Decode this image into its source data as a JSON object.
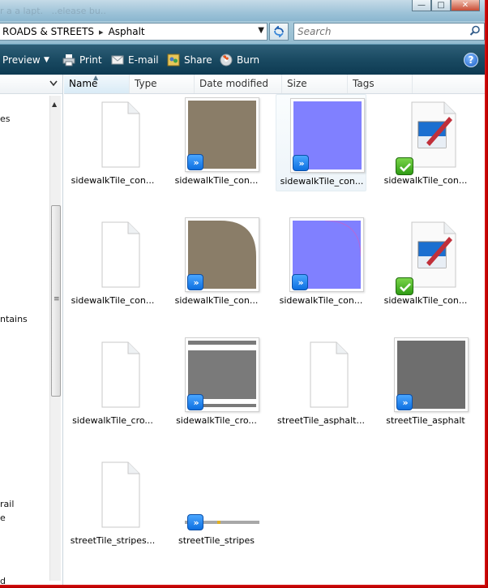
{
  "titlebar": {
    "ghost_text": "r a a lapt.   ..elease bu.."
  },
  "address": {
    "crumbs": [
      "ROADS & STREETS",
      "Asphalt"
    ]
  },
  "search": {
    "placeholder": "Search"
  },
  "toolbar": {
    "preview": "Preview",
    "print": "Print",
    "email": "E-mail",
    "share": "Share",
    "burn": "Burn"
  },
  "nav": {
    "fragments": [
      "es",
      "ntains",
      "rail",
      "e",
      "d"
    ]
  },
  "columns": [
    "Name",
    "Type",
    "Date modified",
    "Size",
    "Tags"
  ],
  "files": [
    {
      "name": "sidewalkTile_con...",
      "kind": "blank"
    },
    {
      "name": "sidewalkTile_con...",
      "kind": "brown",
      "badge": "shortcut"
    },
    {
      "name": "sidewalkTile_con...",
      "kind": "blue",
      "badge": "shortcut",
      "selected": true
    },
    {
      "name": "sidewalkTile_con...",
      "kind": "paint",
      "badge": "check"
    },
    {
      "name": "sidewalkTile_con...",
      "kind": "blank"
    },
    {
      "name": "sidewalkTile_con...",
      "kind": "brown-curve",
      "badge": "shortcut"
    },
    {
      "name": "sidewalkTile_con...",
      "kind": "blue-curve",
      "badge": "shortcut"
    },
    {
      "name": "sidewalkTile_con...",
      "kind": "paint",
      "badge": "check"
    },
    {
      "name": "sidewalkTile_cro...",
      "kind": "blank"
    },
    {
      "name": "sidewalkTile_cro...",
      "kind": "gray-stripes",
      "badge": "shortcut"
    },
    {
      "name": "streetTile_asphalt...",
      "kind": "blank"
    },
    {
      "name": "streetTile_asphalt",
      "kind": "dark-gray",
      "badge": "shortcut"
    },
    {
      "name": "streetTile_stripes...",
      "kind": "blank"
    },
    {
      "name": "streetTile_stripes",
      "kind": "thin-stripe",
      "badge": "shortcut"
    }
  ],
  "colors": {
    "toolbar": "#1a4a62",
    "blue_tile": "#8080ff",
    "brown_tile": "#8a7d68",
    "badge": "#1c7ff0"
  }
}
